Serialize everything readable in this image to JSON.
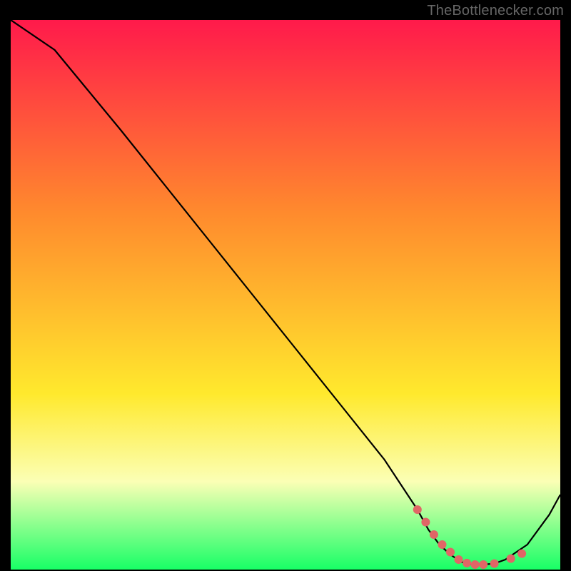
{
  "attribution": "TheBottlenecker.com",
  "colors": {
    "page_bg": "#000000",
    "gradient_top": "#ff1a4b",
    "gradient_mid_upper": "#ff8a2d",
    "gradient_mid_lower": "#ffe92d",
    "gradient_band": "#fbffb5",
    "gradient_bottom": "#18ff66",
    "curve": "#000000",
    "marker": "#e06666"
  },
  "chart_data": {
    "type": "line",
    "title": "",
    "xlabel": "",
    "ylabel": "",
    "xlim": [
      0,
      100
    ],
    "ylim": [
      0,
      110
    ],
    "series": [
      {
        "name": "bottleneck-curve",
        "x": [
          0,
          8,
          14,
          20,
          28,
          36,
          44,
          52,
          60,
          68,
          74,
          76,
          78,
          80,
          82,
          84,
          86,
          88,
          90,
          94,
          98,
          100
        ],
        "y": [
          110,
          104,
          96,
          88,
          77,
          66,
          55,
          44,
          33,
          22,
          12,
          8,
          5,
          3,
          1.5,
          1,
          1,
          1.2,
          2,
          5,
          11,
          15
        ]
      }
    ],
    "markers": {
      "name": "highlighted-points",
      "x": [
        74,
        75.5,
        77,
        78.5,
        80,
        81.5,
        83,
        84.5,
        86,
        88,
        91,
        93
      ],
      "y": [
        12,
        9.5,
        7,
        5,
        3.5,
        2,
        1.3,
        1,
        1,
        1.2,
        2.2,
        3.2
      ]
    }
  }
}
